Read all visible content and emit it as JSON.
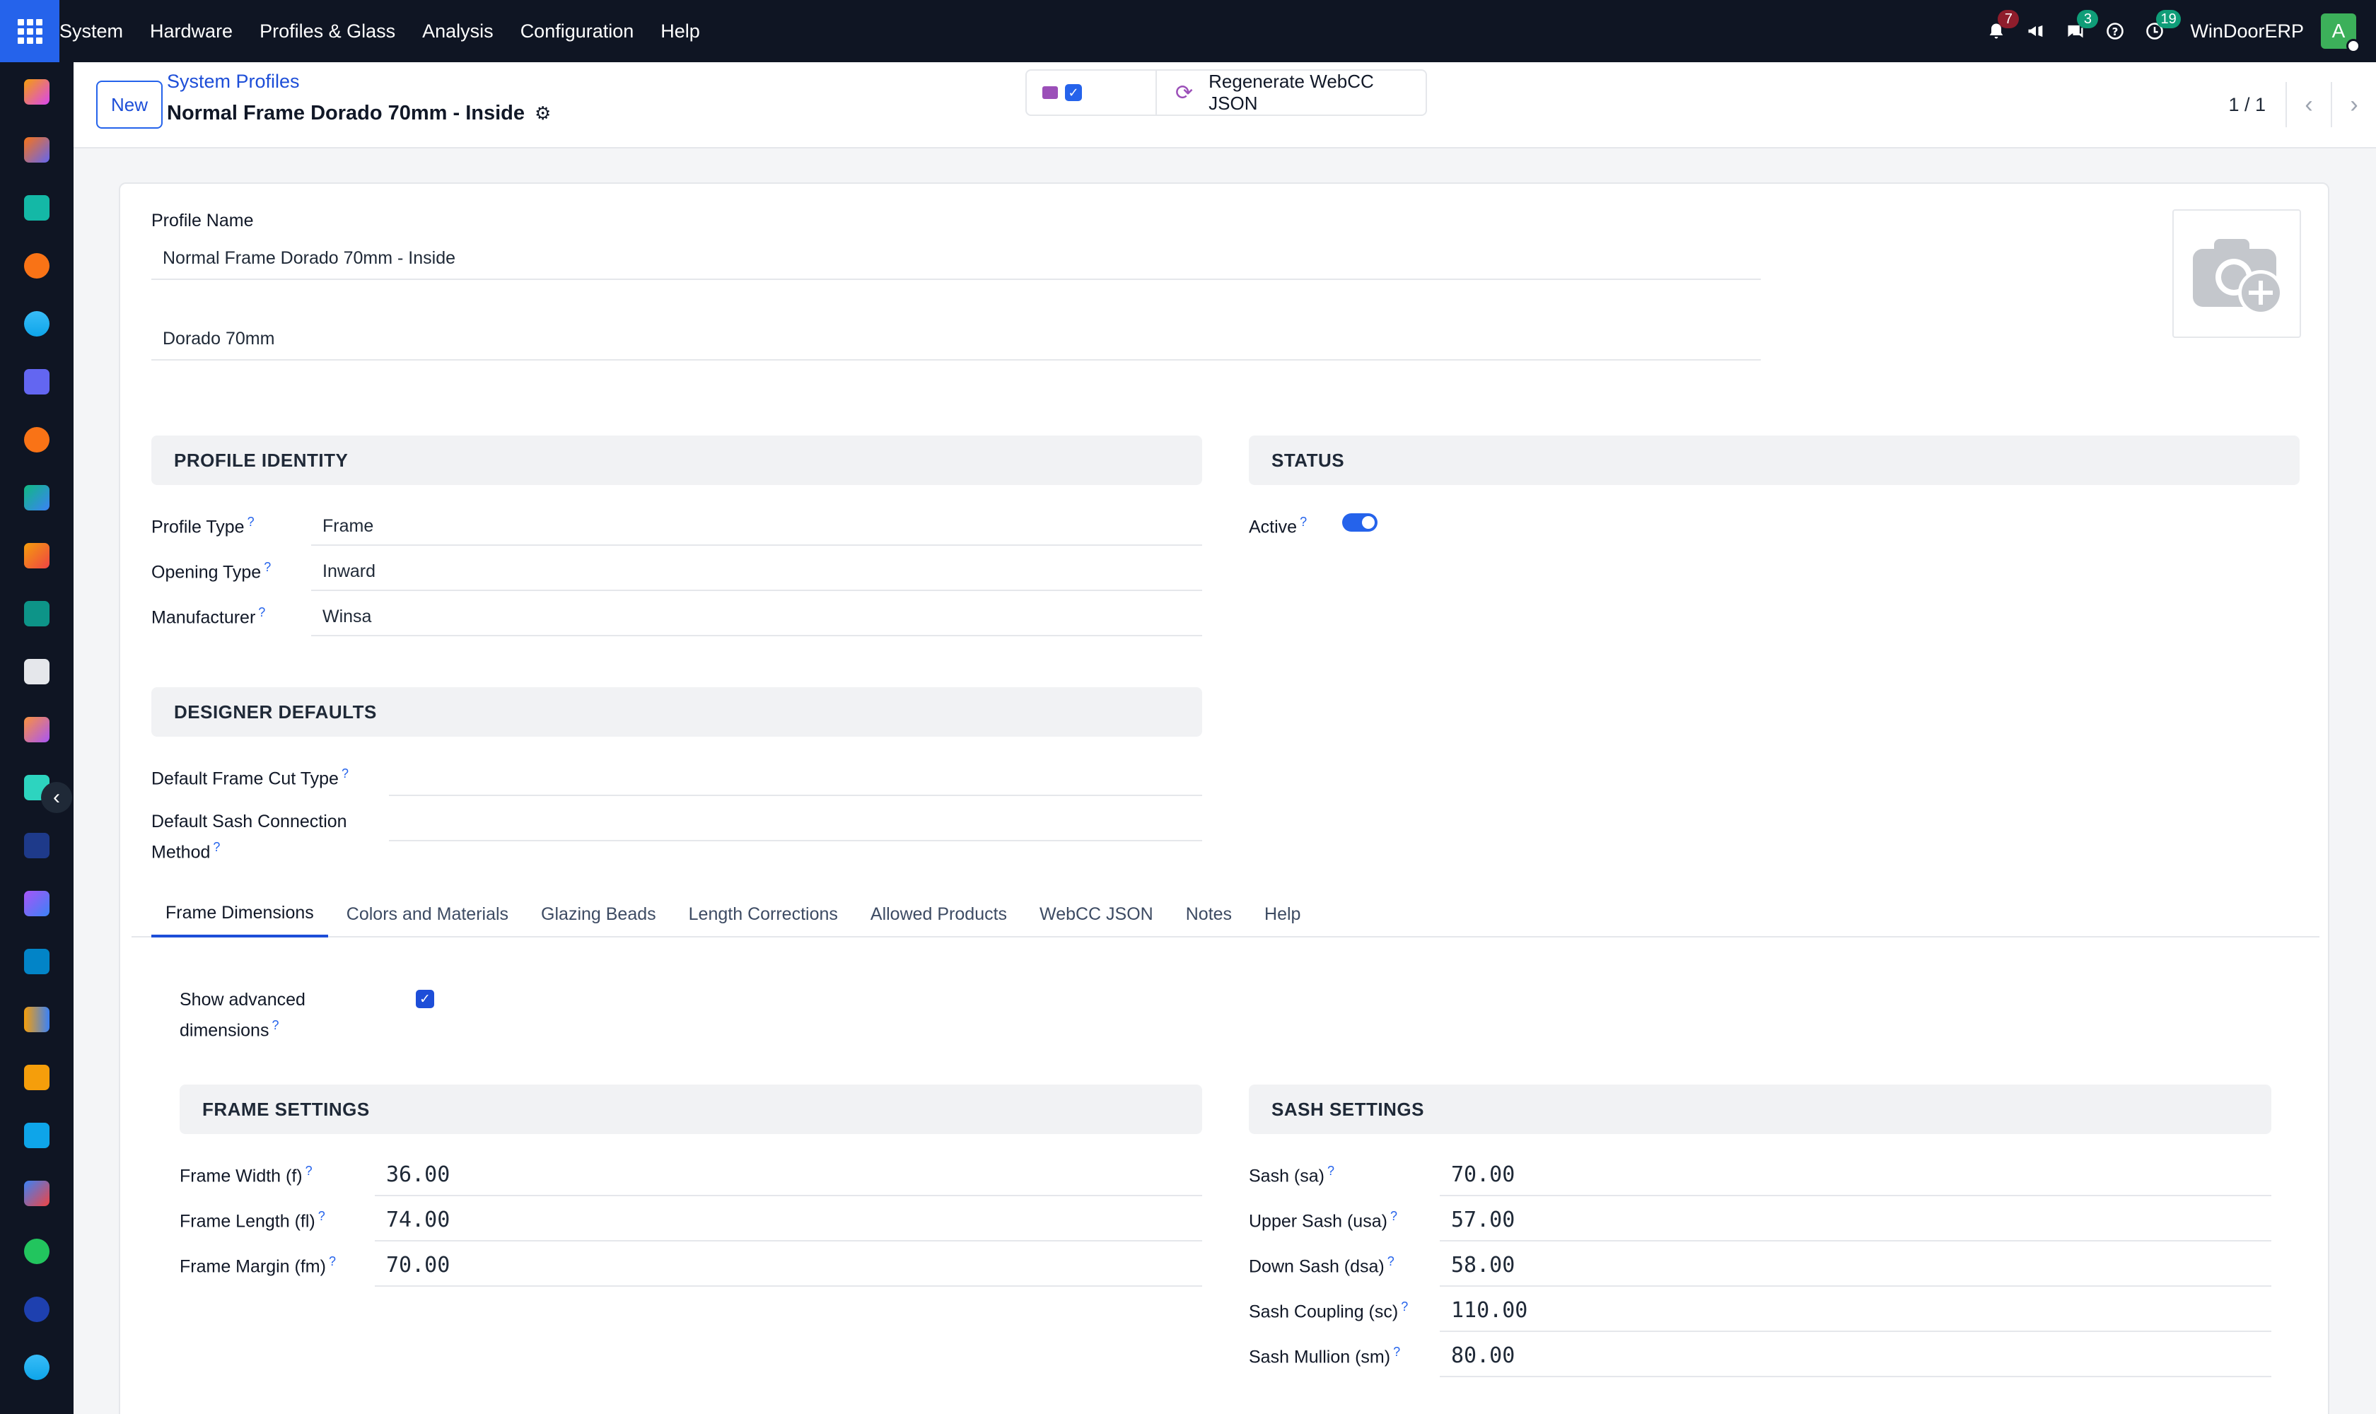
{
  "topnav": {
    "menu": [
      "System",
      "Hardware",
      "Profiles & Glass",
      "Analysis",
      "Configuration",
      "Help"
    ],
    "badges": {
      "notifications": "7",
      "messages": "3",
      "activities": "19"
    },
    "company": "WinDoorERP",
    "avatar_initial": "A"
  },
  "control_panel": {
    "new_label": "New",
    "breadcrumb": "System Profiles",
    "title": "Normal Frame Dorado 70mm - Inside",
    "regen_label": "Regenerate WebCC JSON",
    "pager": "1 / 1"
  },
  "form": {
    "profile_name_label": "Profile Name",
    "profile_name_value": "Normal Frame Dorado 70mm - Inside",
    "series_value": "Dorado 70mm",
    "identity": {
      "heading": "PROFILE IDENTITY",
      "profile_type_label": "Profile Type",
      "profile_type_value": "Frame",
      "opening_type_label": "Opening Type",
      "opening_type_value": "Inward",
      "manufacturer_label": "Manufacturer",
      "manufacturer_value": "Winsa"
    },
    "status": {
      "heading": "STATUS",
      "active_label": "Active",
      "active": true
    },
    "designer": {
      "heading": "DESIGNER DEFAULTS",
      "frame_cut_label": "Default Frame Cut Type",
      "sash_conn_label_1": "Default Sash Connection",
      "sash_conn_label_2": "Method"
    },
    "tabs": [
      "Frame Dimensions",
      "Colors and Materials",
      "Glazing Beads",
      "Length Corrections",
      "Allowed Products",
      "WebCC JSON",
      "Notes",
      "Help"
    ],
    "advanced_label_1": "Show advanced",
    "advanced_label_2": "dimensions",
    "frame": {
      "heading": "FRAME SETTINGS",
      "width_label": "Frame Width (f)",
      "width_value": "36.00",
      "length_label": "Frame Length (fl)",
      "length_value": "74.00",
      "margin_label": "Frame Margin (fm)",
      "margin_value": "70.00"
    },
    "sash": {
      "heading": "SASH SETTINGS",
      "sa_label": "Sash (sa)",
      "sa_value": "70.00",
      "usa_label": "Upper Sash (usa)",
      "usa_value": "57.00",
      "dsa_label": "Down Sash (dsa)",
      "dsa_value": "58.00",
      "sc_label": "Sash Coupling (sc)",
      "sc_value": "110.00",
      "sm_label": "Sash Mullion (sm)",
      "sm_value": "80.00"
    }
  }
}
